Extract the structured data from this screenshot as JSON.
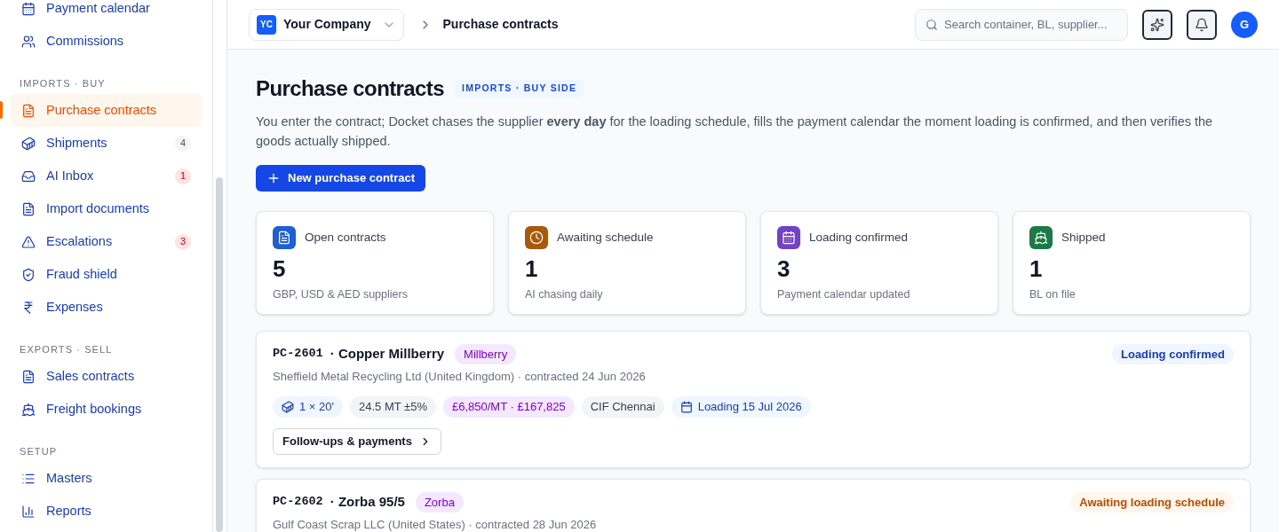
{
  "sidebar": {
    "top_items": [
      {
        "label": "Payment calendar",
        "selected": false
      },
      {
        "label": "Commissions",
        "selected": false
      }
    ],
    "sections": [
      {
        "title": "IMPORTS · BUY",
        "items": [
          {
            "label": "Purchase contracts",
            "selected": true
          },
          {
            "label": "Shipments",
            "selected": false,
            "badge": {
              "text": "4",
              "kind": "neutral"
            }
          },
          {
            "label": "AI Inbox",
            "selected": false,
            "badge": {
              "text": "1",
              "kind": "alert"
            }
          },
          {
            "label": "Import documents",
            "selected": false
          },
          {
            "label": "Escalations",
            "selected": false,
            "badge": {
              "text": "3",
              "kind": "alert"
            }
          },
          {
            "label": "Fraud shield",
            "selected": false
          },
          {
            "label": "Expenses",
            "selected": false
          }
        ]
      },
      {
        "title": "EXPORTS · SELL",
        "items": [
          {
            "label": "Sales contracts",
            "selected": false
          },
          {
            "label": "Freight bookings",
            "selected": false
          }
        ]
      },
      {
        "title": "SETUP",
        "items": [
          {
            "label": "Masters",
            "selected": false
          },
          {
            "label": "Reports",
            "selected": false
          }
        ]
      }
    ]
  },
  "header": {
    "company_badge": "YC",
    "company": "Your Company",
    "breadcrumb": "Purchase contracts",
    "search": {
      "placeholder": "Search container, BL, supplier..."
    },
    "avatar": "G"
  },
  "page": {
    "title": "Purchase contracts",
    "tag": "IMPORTS · BUY SIDE",
    "description": "You enter the contract; Docket chases the supplier **every day** for the loading schedule, fills the payment calendar the moment loading is confirmed, and then verifies the goods actually shipped.",
    "primary_button": "New purchase contract"
  },
  "stats": [
    {
      "label": "Open contracts",
      "value": "5",
      "note": "GBP, USD & AED suppliers",
      "color": "#1f5fd1"
    },
    {
      "label": "Awaiting schedule",
      "value": "1",
      "note": "AI chasing daily",
      "color": "#a8590b"
    },
    {
      "label": "Loading confirmed",
      "value": "3",
      "note": "Payment calendar updated",
      "color": "#7341c4"
    },
    {
      "label": "Shipped",
      "value": "1",
      "note": "BL on file",
      "color": "#1b7a45"
    }
  ],
  "contracts": [
    {
      "code": "PC-2601",
      "name": "· Copper Millberry",
      "grade": "Millberry",
      "supplier": "Sheffield Metal Recycling Ltd (United Kingdom) · contracted 24 Jun 2026",
      "status": {
        "text": "Loading confirmed",
        "kind": "confirmed"
      },
      "chips": [
        {
          "kind": "container",
          "text": "1 × 20'"
        },
        {
          "kind": "plain",
          "text": "24.5 MT ±5%"
        },
        {
          "kind": "price",
          "text": "£6,850/MT · £167,825"
        },
        {
          "kind": "plain",
          "text": "CIF Chennai"
        },
        {
          "kind": "date",
          "text": "Loading 15 Jul 2026"
        }
      ],
      "action": "Follow-ups & payments"
    },
    {
      "code": "PC-2602",
      "name": "· Zorba 95/5",
      "grade": "Zorba",
      "supplier": "Gulf Coast Scrap LLC (United States) · contracted 28 Jun 2026",
      "status": {
        "text": "Awaiting loading schedule",
        "kind": "awaiting"
      }
    }
  ]
}
